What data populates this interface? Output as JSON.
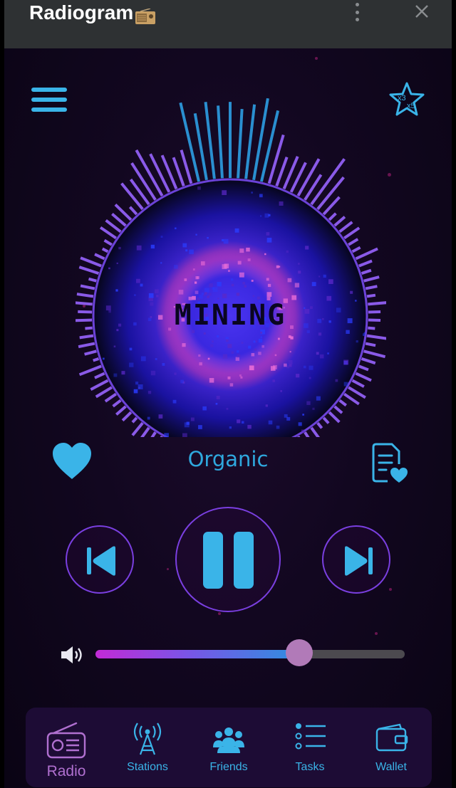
{
  "window": {
    "title": "Radiogram",
    "title_emoji_icon": "radio-emoji-icon"
  },
  "colors": {
    "accent": "#3ab4e8",
    "accent_purple": "#7a3fe0",
    "active_nav": "#b070d0",
    "background": "#120720"
  },
  "visualizer": {
    "cover_text": "MINING"
  },
  "player": {
    "track_title": "Organic",
    "state": "playing",
    "volume_percent": 66,
    "like_icon": "heart-icon",
    "lyrics_icon": "favorite-list-icon",
    "boost_icon": "boost-star-icon",
    "boost_labels": [
      "x3",
      "x5"
    ]
  },
  "nav": {
    "items": [
      {
        "label": "Radio",
        "icon": "radio-icon",
        "active": true
      },
      {
        "label": "Stations",
        "icon": "antenna-icon",
        "active": false
      },
      {
        "label": "Friends",
        "icon": "friends-icon",
        "active": false
      },
      {
        "label": "Tasks",
        "icon": "tasks-icon",
        "active": false
      },
      {
        "label": "Wallet",
        "icon": "wallet-icon",
        "active": false
      }
    ]
  }
}
